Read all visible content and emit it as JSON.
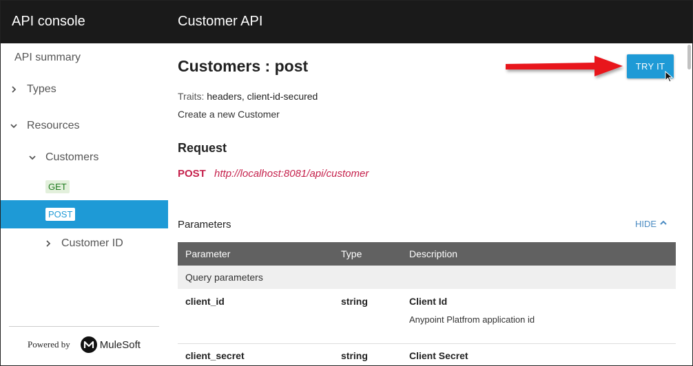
{
  "header": {
    "app_title": "API console",
    "api_title": "Customer API"
  },
  "sidebar": {
    "summary": "API summary",
    "types": "Types",
    "resources": "Resources",
    "customers": "Customers",
    "get_badge": "GET",
    "post_badge": "POST",
    "customer_id": "Customer ID",
    "powered_by": "Powered by",
    "brand": "MuleSoft"
  },
  "main": {
    "title_resource": "Customers",
    "title_sep": " : ",
    "title_method": "post",
    "try_it": "TRY IT",
    "traits_label": "Traits:",
    "traits_value": "headers, client-id-secured",
    "description": "Create a new Customer",
    "request_heading": "Request",
    "request_method": "POST",
    "request_url": "http://localhost:8081/api/customer",
    "parameters_heading": "Parameters",
    "hide_label": "HIDE"
  },
  "parameters_table": {
    "headers": [
      "Parameter",
      "Type",
      "Description"
    ],
    "section": "Query parameters",
    "rows": [
      {
        "name": "client_id",
        "type": "string",
        "desc_title": "Client Id",
        "desc_sub": "Anypoint Platfrom application id"
      },
      {
        "name": "client_secret",
        "type": "string",
        "desc_title": "Client Secret",
        "desc_sub": ""
      }
    ]
  },
  "colors": {
    "accent": "#1e9ad6",
    "topbar": "#1a1a1a",
    "method": "#c5204b",
    "get_badge_bg": "#e3f0dc",
    "arrow": "#e8141c"
  }
}
